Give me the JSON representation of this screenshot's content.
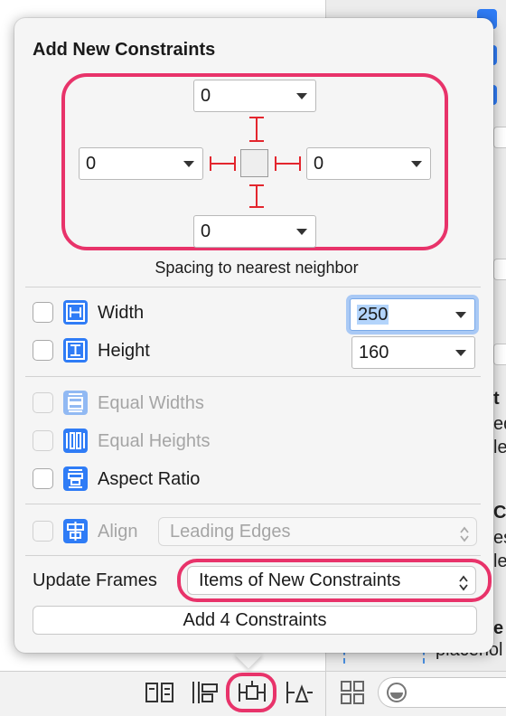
{
  "popover": {
    "title": "Add New Constraints",
    "spacing": {
      "top": "0",
      "left": "0",
      "right": "0",
      "bottom": "0",
      "caption": "Spacing to nearest neighbor"
    },
    "size": {
      "width_label": "Width",
      "width_value": "250",
      "height_label": "Height",
      "height_value": "160"
    },
    "options": {
      "equal_widths": "Equal Widths",
      "equal_heights": "Equal Heights",
      "aspect_ratio": "Aspect Ratio"
    },
    "align": {
      "label": "Align",
      "value": "Leading Edges"
    },
    "update_frames": {
      "label": "Update Frames",
      "value": "Items of New Constraints"
    },
    "add_button": "Add 4 Constraints"
  },
  "background": {
    "inspector_texts": [
      "t",
      "ed",
      "le",
      "C",
      "es",
      "le",
      "e",
      "placehol"
    ]
  },
  "colors": {
    "highlight": "#e8336a",
    "accent": "#2f7cf6",
    "strut": "#e3262e"
  },
  "icons": [
    "width-constraint-icon",
    "height-constraint-icon",
    "equal-widths-icon",
    "equal-heights-icon",
    "aspect-ratio-icon",
    "align-icon",
    "stack-icon",
    "align-tool-icon",
    "add-constraints-tool-icon",
    "resolve-issues-icon",
    "grid-icon",
    "filter-icon"
  ]
}
